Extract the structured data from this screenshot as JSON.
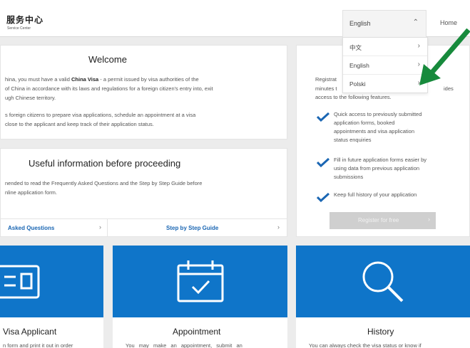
{
  "header": {
    "logo_text": "服务中心",
    "logo_subtitle": "Service Center",
    "language_label": "English",
    "home_label": "Home"
  },
  "language_menu": {
    "items": [
      {
        "label": "中文"
      },
      {
        "label": "English"
      },
      {
        "label": "Polski"
      }
    ]
  },
  "welcome": {
    "title": "Welcome",
    "p1_l1_pre": "hina, you must have a valid ",
    "p1_l1_bold": "China Visa",
    "p1_l1_post": " - a permit issued by visa authorities of the",
    "p1_l2": "of China in accordance with its laws and regulations for a foreign citizen's entry into, exit",
    "p1_l3": "ugh Chinese territory.",
    "p2_l1": "s foreign citizens to prepare visa applications, schedule an appointment at a visa",
    "p2_l2": "close to the applicant and keep track of their application status."
  },
  "useful_info": {
    "title": "Useful information before proceeding",
    "l1": "nended to read the Frequently Asked Questions and the Step by Step Guide before",
    "l2": "nline application form.",
    "faq_link": "Asked Questions",
    "guide_link": "Step by Step Guide"
  },
  "registration": {
    "l1": "Registrat",
    "l1b": "ides",
    "l2": "minutes t",
    "l3": "access to the following features.",
    "features": [
      {
        "lines": [
          "Quick access to previously submitted",
          "application forms, booked",
          "appointments and visa application",
          "status enquiries"
        ]
      },
      {
        "lines": [
          "Fill in future application forms easier by",
          "using data from previous application",
          "submissions"
        ]
      },
      {
        "lines": [
          "Keep full history of your application"
        ]
      }
    ],
    "button_label": "Register for free"
  },
  "tiles": [
    {
      "title": "Visa Applicant",
      "text": "n form and print it out in order"
    },
    {
      "title": "Appointment",
      "text": "You may make an appointment, submit an"
    },
    {
      "title": "History",
      "text": "You can always check the visa status or know if"
    }
  ],
  "colors": {
    "tile_blue": "#0f75c9",
    "link_blue": "#1a66b3",
    "check_blue": "#1a66b3",
    "arrow_green": "#178a3c"
  }
}
